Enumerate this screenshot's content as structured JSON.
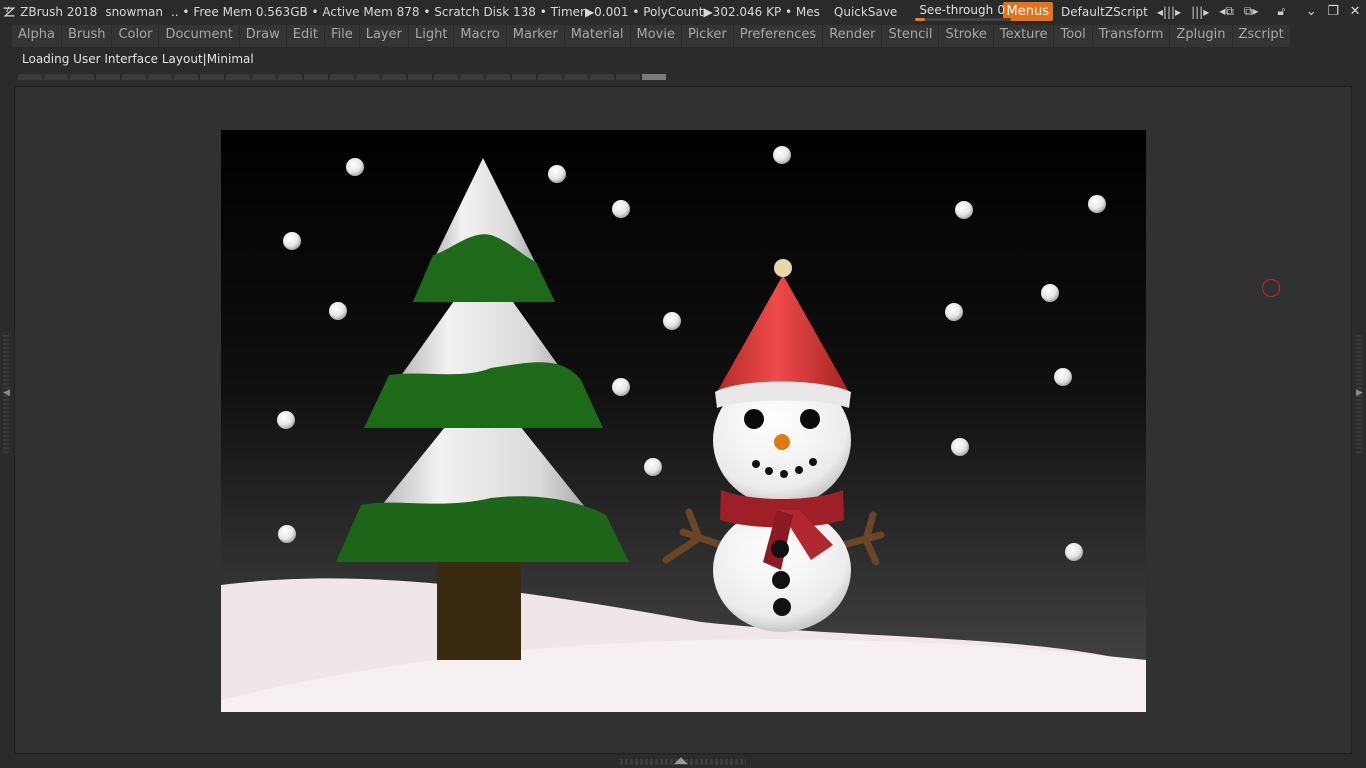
{
  "titlebar": {
    "app": "ZBrush 2018",
    "document": "snowman",
    "stats": ".. • Free Mem 0.563GB • Active Mem 878 • Scratch Disk 138 •  Timer▶0.001 • PolyCount▶302.046 KP  • Mes",
    "quicksave": "QuickSave",
    "see_through_label": "See-through",
    "see_through_value": "0",
    "see_through_level": 0.1,
    "menus": "Menus",
    "zscript": "DefaultZScript",
    "icons": [
      "prev-next-layout-icon",
      "layout-arrows-icon",
      "layout-left-icon",
      "layout-right-icon",
      "lock-icon"
    ],
    "window_controls": {
      "minimize": "⌄",
      "restore": "❐",
      "close": "✕"
    }
  },
  "menubar": {
    "items": [
      "Alpha",
      "Brush",
      "Color",
      "Document",
      "Draw",
      "Edit",
      "File",
      "Layer",
      "Light",
      "Macro",
      "Marker",
      "Material",
      "Movie",
      "Picker",
      "Preferences",
      "Render",
      "Stencil",
      "Stroke",
      "Texture",
      "Tool",
      "Transform",
      "Zplugin",
      "Zscript"
    ]
  },
  "status": {
    "text": "Loading User Interface Layout|Minimal"
  },
  "progress": {
    "segments": 25,
    "active_segment": 24
  },
  "canvas": {
    "scene": "snowman",
    "colors": {
      "sky_top": "#000000",
      "sky_bottom": "#474747",
      "snow": "#f2e9ea",
      "tree_green": "#1e6a1a",
      "trunk": "#3b2a12",
      "hat_red": "#d93a3a",
      "scarf_red": "#9e1f25",
      "carrot": "#e07a10"
    }
  }
}
